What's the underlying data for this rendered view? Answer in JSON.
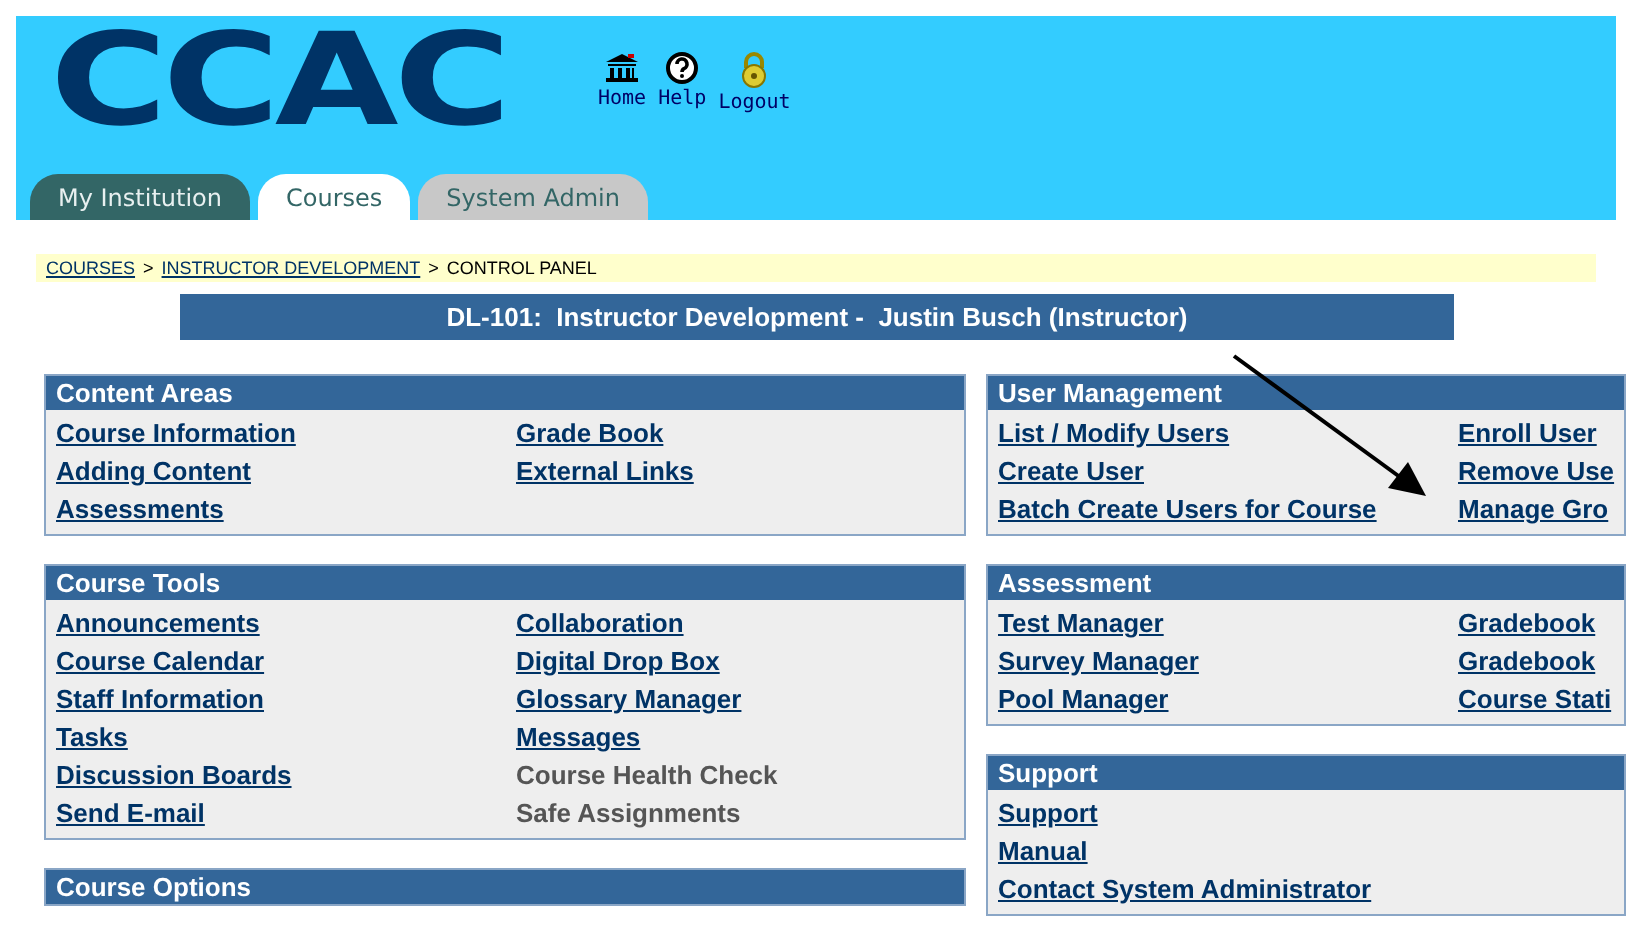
{
  "header": {
    "logo": "CCAC",
    "nav": [
      {
        "kind": "home",
        "label": "Home"
      },
      {
        "kind": "help",
        "label": "Help"
      },
      {
        "kind": "logout",
        "label": "Logout"
      }
    ]
  },
  "tabs": [
    {
      "label": "My Institution",
      "selected": false,
      "kind": "dark"
    },
    {
      "label": "Courses",
      "selected": true,
      "kind": "light"
    },
    {
      "label": "System Admin",
      "selected": false,
      "kind": "grey"
    }
  ],
  "breadcrumb": [
    {
      "label": "COURSES",
      "link": true
    },
    {
      "separator": ">",
      "label": "INSTRUCTOR DEVELOPMENT",
      "link": true
    },
    {
      "separator": ">",
      "label": "CONTROL PANEL",
      "link": false
    }
  ],
  "title": "DL-101:  Instructor Development -  Justin Busch (Instructor)",
  "columns": [
    [
      {
        "title": "Content Areas",
        "items": [
          [
            {
              "label": "Course Information",
              "disabled": false
            },
            {
              "label": "Adding Content",
              "disabled": false
            },
            {
              "label": "Assessments",
              "disabled": false
            }
          ],
          [
            {
              "label": "Grade Book",
              "disabled": false
            },
            {
              "label": "External Links",
              "disabled": false
            }
          ]
        ]
      },
      {
        "title": "Course Tools",
        "items": [
          [
            {
              "label": "Announcements",
              "disabled": false
            },
            {
              "label": "Course Calendar",
              "disabled": false
            },
            {
              "label": "Staff Information",
              "disabled": false
            },
            {
              "label": "Tasks",
              "disabled": false
            },
            {
              "label": "Discussion Boards",
              "disabled": false
            },
            {
              "label": "Send E-mail",
              "disabled": false
            }
          ],
          [
            {
              "label": "Collaboration",
              "disabled": false
            },
            {
              "label": "Digital Drop Box",
              "disabled": false
            },
            {
              "label": "Glossary Manager",
              "disabled": false
            },
            {
              "label": "Messages",
              "disabled": false
            },
            {
              "label": "Course Health Check",
              "disabled": true
            },
            {
              "label": "Safe Assignments",
              "disabled": true
            }
          ]
        ]
      },
      {
        "title": "Course Options"
      }
    ],
    [
      {
        "title": "User Management",
        "items": [
          [
            {
              "label": "List / Modify Users",
              "disabled": false
            },
            {
              "label": "Create User",
              "disabled": false
            },
            {
              "label": "Batch Create Users for Course",
              "disabled": false
            }
          ],
          [
            {
              "label": "Enroll User",
              "disabled": false
            },
            {
              "label": "Remove Use",
              "disabled": false
            },
            {
              "label": "Manage Gro",
              "disabled": false
            }
          ]
        ]
      },
      {
        "title": "Assessment",
        "items": [
          [
            {
              "label": "Test Manager",
              "disabled": false
            },
            {
              "label": "Survey Manager",
              "disabled": false
            },
            {
              "label": "Pool Manager",
              "disabled": false
            }
          ],
          [
            {
              "label": "Gradebook",
              "disabled": false
            },
            {
              "label": "Gradebook",
              "disabled": false
            },
            {
              "label": "Course Stati",
              "disabled": false
            }
          ]
        ]
      },
      {
        "title": "Support",
        "items": [
          [
            {
              "label": "Support",
              "disabled": false
            },
            {
              "label": "Manual",
              "disabled": false
            },
            {
              "label": "Contact System Administrator",
              "disabled": false
            }
          ]
        ]
      }
    ]
  ]
}
